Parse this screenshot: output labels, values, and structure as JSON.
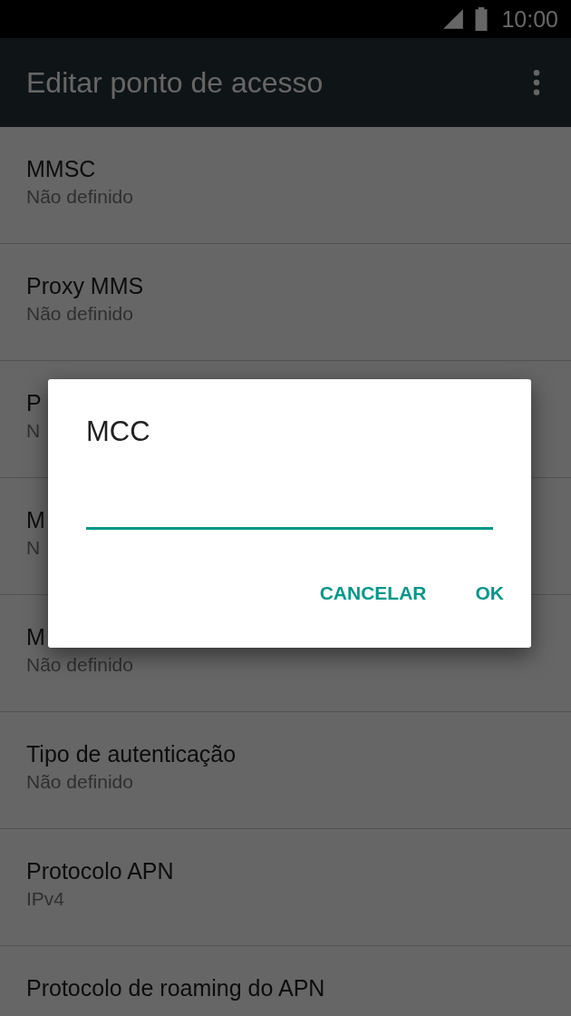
{
  "status_bar": {
    "time": "10:00"
  },
  "toolbar": {
    "title": "Editar ponto de acesso"
  },
  "settings": [
    {
      "title": "MMSC",
      "summary": "Não definido"
    },
    {
      "title": "Proxy MMS",
      "summary": "Não definido"
    },
    {
      "title": "P",
      "summary": "N"
    },
    {
      "title": "M",
      "summary": "N"
    },
    {
      "title": "M",
      "summary": "Não definido"
    },
    {
      "title": "Tipo de autenticação",
      "summary": "Não definido"
    },
    {
      "title": "Protocolo APN",
      "summary": "IPv4"
    },
    {
      "title": "Protocolo de roaming do APN"
    }
  ],
  "dialog": {
    "title": "MCC",
    "buttons": [
      "CANCELAR",
      "OK"
    ]
  }
}
